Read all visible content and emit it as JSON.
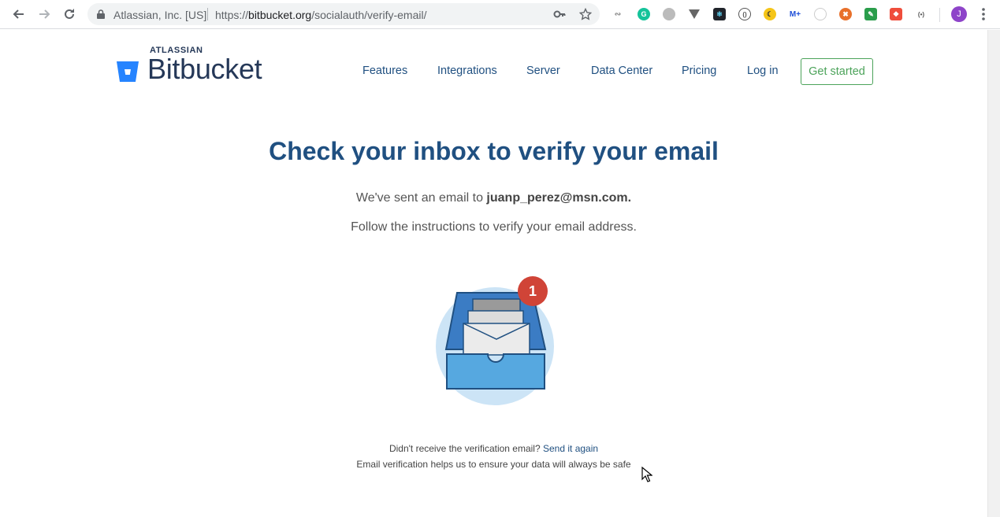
{
  "browser": {
    "site_identity": "Atlassian, Inc. [US]",
    "url_prefix": "https://",
    "url_host": "bitbucket.org",
    "url_path": "/socialauth/verify-email/",
    "avatar_letter": "J"
  },
  "header": {
    "brand_top": "ATLASSIAN",
    "brand_name": "Bitbucket",
    "nav": [
      "Features",
      "Integrations",
      "Server",
      "Data Center",
      "Pricing",
      "Log in"
    ],
    "cta": "Get started"
  },
  "main": {
    "title": "Check your inbox to verify your email",
    "sent_prefix": "We've sent an email to ",
    "email": "juanp_perez@msn.com.",
    "instructions": "Follow the instructions to verify your email address.",
    "badge_count": "1"
  },
  "footer": {
    "not_received": "Didn't receive the verification email?",
    "resend_link": "Send it again",
    "safety_note": "Email verification helps us to ensure your data will always be safe"
  },
  "colors": {
    "brand_blue": "#205081",
    "cta_green": "#4ca35a",
    "badge_red": "#d04437"
  }
}
